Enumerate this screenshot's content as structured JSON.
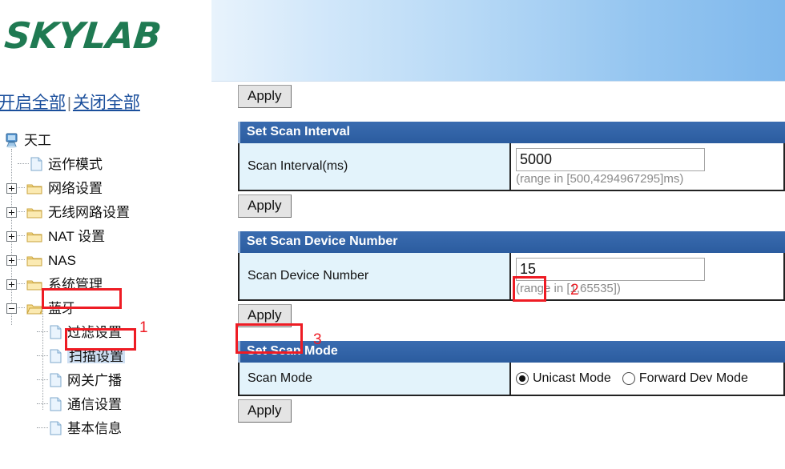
{
  "brand": {
    "logo_text": "SKYLAB"
  },
  "quick_links": {
    "expand_all": "开启全部",
    "separator": "|",
    "collapse_all": "关闭全部"
  },
  "tree": {
    "nodes": [
      {
        "label": "天工",
        "level": 0,
        "icon": "computer-icon",
        "expander": "none"
      },
      {
        "label": "运作模式",
        "level": 1,
        "icon": "document-icon",
        "expander": "none"
      },
      {
        "label": "网络设置",
        "level": 1,
        "icon": "folder-icon",
        "expander": "plus"
      },
      {
        "label": "无线网路设置",
        "level": 1,
        "icon": "folder-icon",
        "expander": "plus"
      },
      {
        "label": "NAT 设置",
        "level": 1,
        "icon": "folder-icon",
        "expander": "plus"
      },
      {
        "label": "NAS",
        "level": 1,
        "icon": "folder-icon",
        "expander": "plus"
      },
      {
        "label": "系统管理",
        "level": 1,
        "icon": "folder-icon",
        "expander": "plus"
      },
      {
        "label": "蓝牙",
        "level": 1,
        "icon": "folder-open-icon",
        "expander": "minus"
      },
      {
        "label": "过滤设置",
        "level": 2,
        "icon": "document-icon",
        "expander": "none"
      },
      {
        "label": "扫描设置",
        "level": 2,
        "icon": "document-icon",
        "expander": "none"
      },
      {
        "label": "网关广播",
        "level": 2,
        "icon": "document-icon",
        "expander": "none"
      },
      {
        "label": "通信设置",
        "level": 2,
        "icon": "document-icon",
        "expander": "none"
      },
      {
        "label": "基本信息",
        "level": 2,
        "icon": "document-icon",
        "expander": "none"
      }
    ]
  },
  "annotations": {
    "step1": "1",
    "step2": "2",
    "step3": "3",
    "color": "#ee1c24"
  },
  "main": {
    "top_apply_label": "Apply",
    "sections": [
      {
        "title": "Set Scan Interval",
        "field_label": "Scan Interval(ms)",
        "value": "5000",
        "hint": "(range in [500,4294967295]ms)",
        "apply_label": "Apply"
      },
      {
        "title": "Set Scan Device Number",
        "field_label": "Scan Device Number",
        "value": "15",
        "hint": "(range in [1,65535])",
        "apply_label": "Apply"
      },
      {
        "title": "Set Scan Mode",
        "field_label": "Scan Mode",
        "options": [
          {
            "label": "Unicast Mode",
            "selected": true
          },
          {
            "label": "Forward Dev Mode",
            "selected": false
          }
        ],
        "apply_label": "Apply"
      }
    ]
  },
  "colors": {
    "header_blue": "#2f62a8",
    "cell_label_bg": "#e3f3fb",
    "link_blue": "#1b4f9c",
    "logo_green": "#1f7a52"
  }
}
